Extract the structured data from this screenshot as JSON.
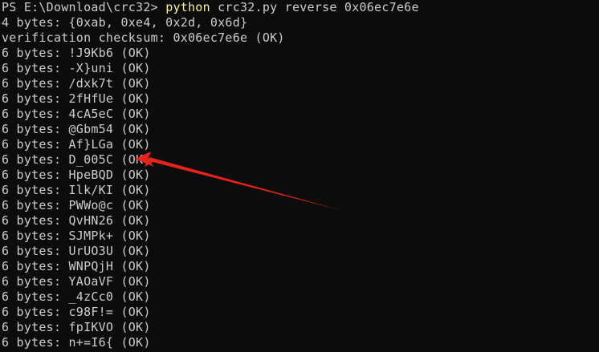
{
  "terminal": {
    "prompt": "PS E:\\Download\\crc32> ",
    "command": "python",
    "args": " crc32.py reverse 0x06ec7e6e",
    "line2": "4 bytes: {0xab, 0xe4, 0x2d, 0x6d}",
    "line3": "verification checksum: 0x06ec7e6e (OK)",
    "results": [
      "6 bytes: !J9Kb6 (OK)",
      "6 bytes: -X}uni (OK)",
      "6 bytes: /dxk7t (OK)",
      "6 bytes: 2fHfUe (OK)",
      "6 bytes: 4cA5eC (OK)",
      "6 bytes: @Gbm54 (OK)",
      "6 bytes: Af}LGa (OK)",
      "6 bytes: D_005C (OK)",
      "6 bytes: HpeBQD (OK)",
      "6 bytes: Ilk/KI (OK)",
      "6 bytes: PWWo@c (OK)",
      "6 bytes: QvHN26 (OK)",
      "6 bytes: SJMPk+ (OK)",
      "6 bytes: UrUO3U (OK)",
      "6 bytes: WNPQjH (OK)",
      "6 bytes: YAOaVF (OK)",
      "6 bytes: _4zCc0 (OK)",
      "6 bytes: c98F!= (OK)",
      "6 bytes: fpIKVO (OK)",
      "6 bytes: n+=I6{ (OK)"
    ]
  },
  "colors": {
    "background": "#0c0c0c",
    "text": "#cccccc",
    "command": "#f9f1a5",
    "annotation": "#e8231c"
  },
  "annotation_icon": "red-arrow"
}
